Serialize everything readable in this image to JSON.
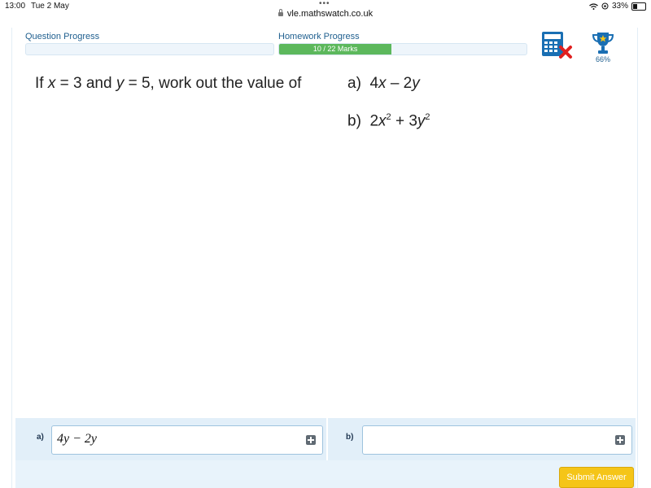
{
  "status_bar": {
    "time": "13:00",
    "date": "Tue 2 May",
    "battery": "33%"
  },
  "browser": {
    "url": "vle.mathswatch.co.uk"
  },
  "header": {
    "question_progress_label": "Question Progress",
    "homework_progress_label": "Homework Progress",
    "homework_marks": "10 / 22 Marks",
    "homework_fraction": 0.4545,
    "trophy_percent": "66%"
  },
  "question": {
    "intro_1": "If ",
    "var_x": "x",
    "intro_2": " = 3 and ",
    "var_y": "y",
    "intro_3": " = 5, work out the value of",
    "part_a_label": "a)",
    "part_a_1": "4",
    "part_a_x": "x",
    "part_a_2": " – 2",
    "part_a_y": "y",
    "part_b_label": "b)",
    "part_b_1": "2",
    "part_b_x": "x",
    "part_b_sup1": "2",
    "part_b_2": " + 3",
    "part_b_y": "y",
    "part_b_sup2": "2"
  },
  "answers": {
    "a_label": "a)",
    "a_value": "4y − 2y",
    "b_label": "b)",
    "b_value": ""
  },
  "submit_label": "Submit Answer",
  "colors": {
    "progress_fill": "#5cb85c",
    "accent_blue": "#1f5f8f",
    "submit": "#f5c518",
    "calc_blue": "#1a6fb3",
    "calc_cross": "#e02020"
  }
}
